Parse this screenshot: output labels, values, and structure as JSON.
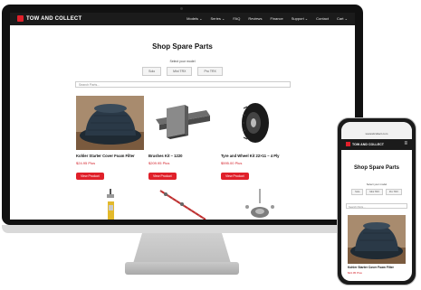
{
  "site": {
    "brand": "TOW AND COLLECT",
    "nav_items": [
      "Models ⌄",
      "Series ⌄",
      "FAQ",
      "Reviews",
      "Finance",
      "Support ⌄",
      "Contact",
      "Cart ⌄"
    ],
    "page_title": "Shop Spare Parts",
    "select_model_label": "Select your model",
    "models": [
      "Solo",
      "Mini TRX",
      "Pro TRX"
    ],
    "search_placeholder": "Search Parts...",
    "view_product_label": "View Product"
  },
  "products": [
    {
      "name": "Kohler Starter Cover Foam Filter",
      "price": "$24.95",
      "price_suffix": "Plus"
    },
    {
      "name": "Brushes Kit – 1220",
      "price": "$209.95",
      "price_suffix": "Plus"
    },
    {
      "name": "Tyre and Wheel Kit 22×11 – 4 Ply",
      "price": "$595.00",
      "price_suffix": "Plus"
    }
  ],
  "mobile": {
    "url": "towandcollect.com",
    "menu_icon": "hamburger-icon",
    "product_name": "Kohler Starter Cover Foam Filter",
    "product_price": "$24.95",
    "product_price_suffix": "Plus"
  },
  "colors": {
    "accent": "#e0202a",
    "nav_bg": "#1b1b1b",
    "price": "#d21d26"
  }
}
